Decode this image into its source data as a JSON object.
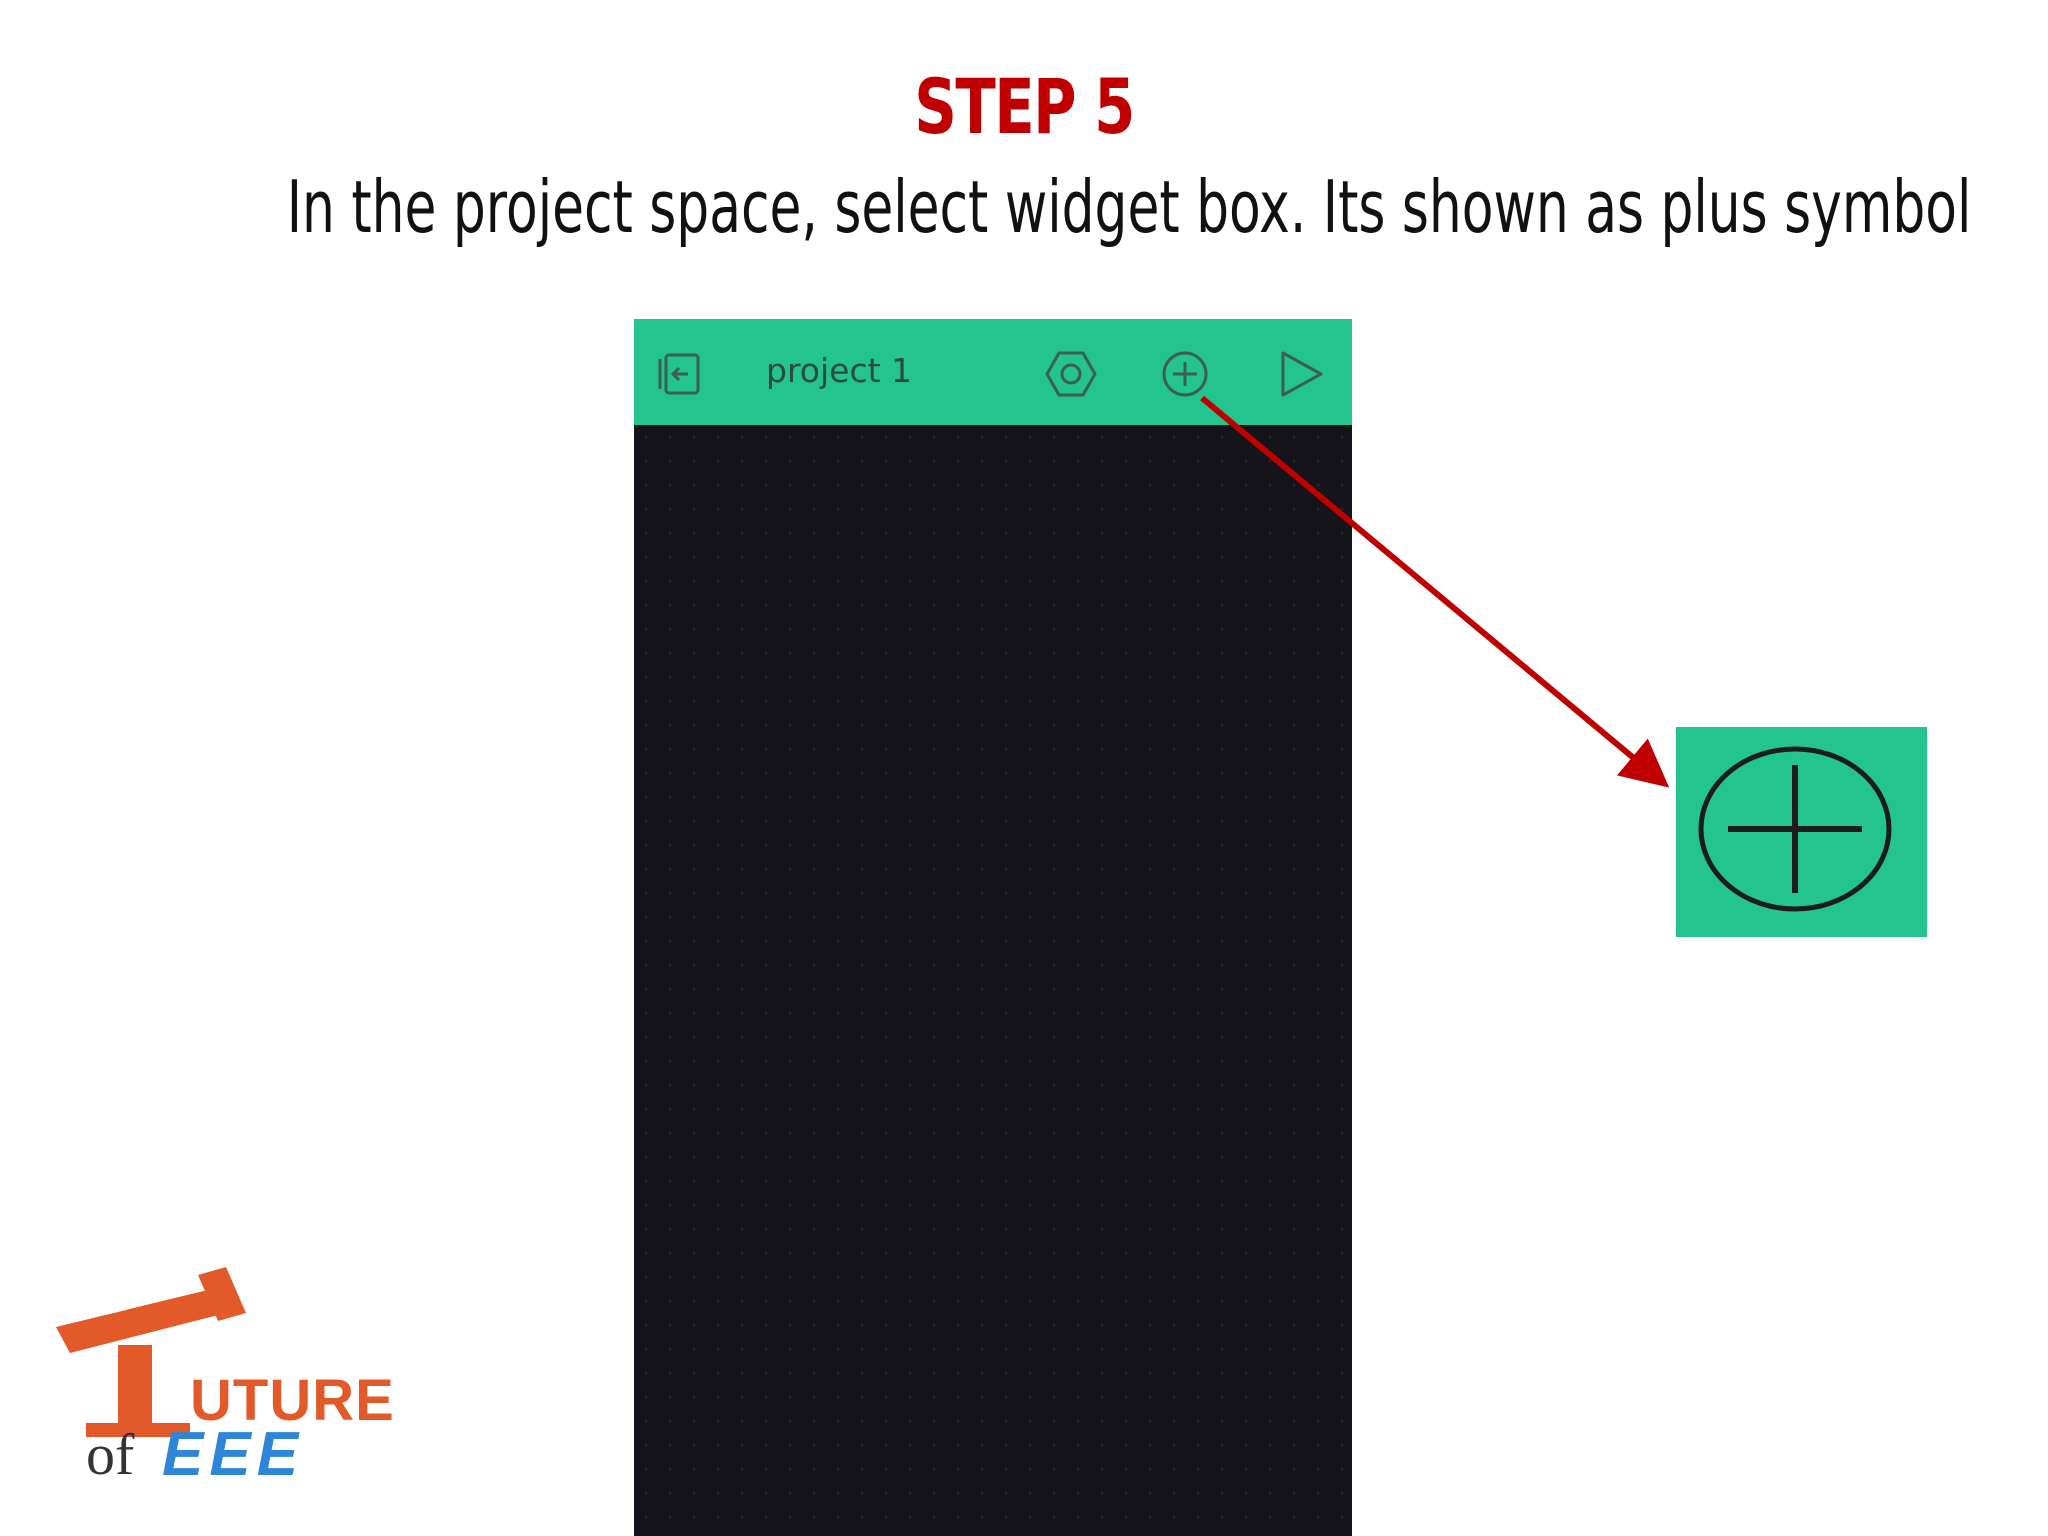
{
  "slide": {
    "step_title": "STEP 5",
    "instruction": "In the project space, select widget box. Its shown as plus symbol"
  },
  "phone": {
    "project_name": "project 1",
    "icons": {
      "exit": "exit-project-icon",
      "settings": "hexagon-settings-icon",
      "add_widget": "plus-circle-icon",
      "play": "play-icon"
    }
  },
  "zoom": {
    "icon": "plus-circle-icon"
  },
  "logo": {
    "future": "UTURE",
    "of": "of",
    "eee": "EEE"
  },
  "colors": {
    "step_title": "#c00000",
    "header_green": "#23c48e",
    "canvas_dark": "#15141a",
    "arrow_red": "#c00000"
  }
}
